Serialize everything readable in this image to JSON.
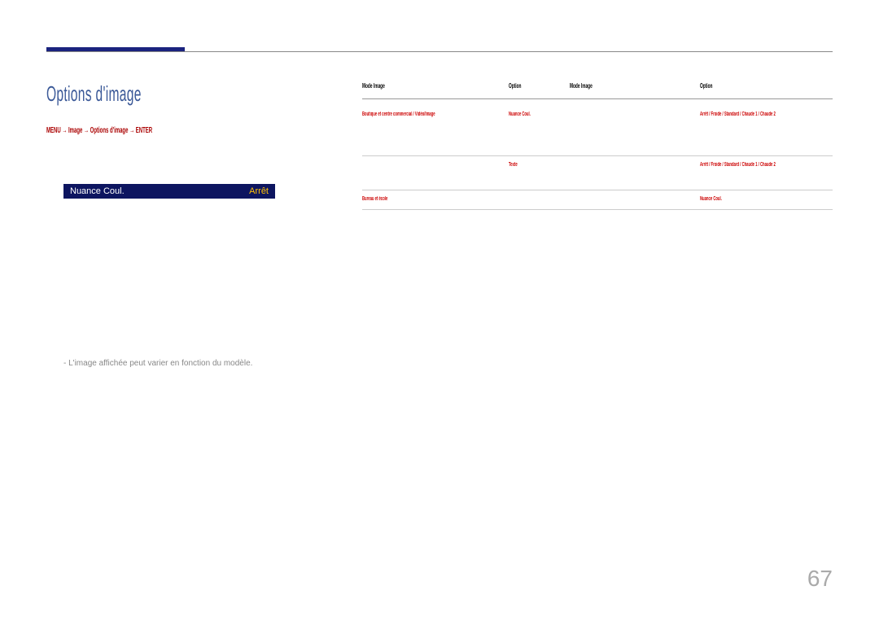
{
  "pageNumber": "67",
  "title": "Options d'image",
  "menuPath": "MENU → Image → Options d'image → ENTER",
  "footnote": "L'image affichée peut varier en fonction du modèle.",
  "menuScreenshot": {
    "label": "Nuance Coul.",
    "value": "Arrêt"
  },
  "tableHeaders": {
    "col1": "Mode Image",
    "col2": "Option",
    "col3": "Mode Image",
    "col4": "Option"
  },
  "tableRows": [
    {
      "col1": "Boutique et centre commercial / Vidéo/Image",
      "col2": "Nuance Coul.",
      "col3": "",
      "col4": "Arrêt / Froide / Standard / Chaude 1 / Chaude 2"
    },
    {
      "col1": "",
      "col2": "Texte",
      "col3": "",
      "col4": "Arrêt / Froide / Standard / Chaude 1 / Chaude 2"
    },
    {
      "col1": "Bureau et école",
      "col2": "",
      "col3": "",
      "col4": "Nuance Coul."
    }
  ]
}
